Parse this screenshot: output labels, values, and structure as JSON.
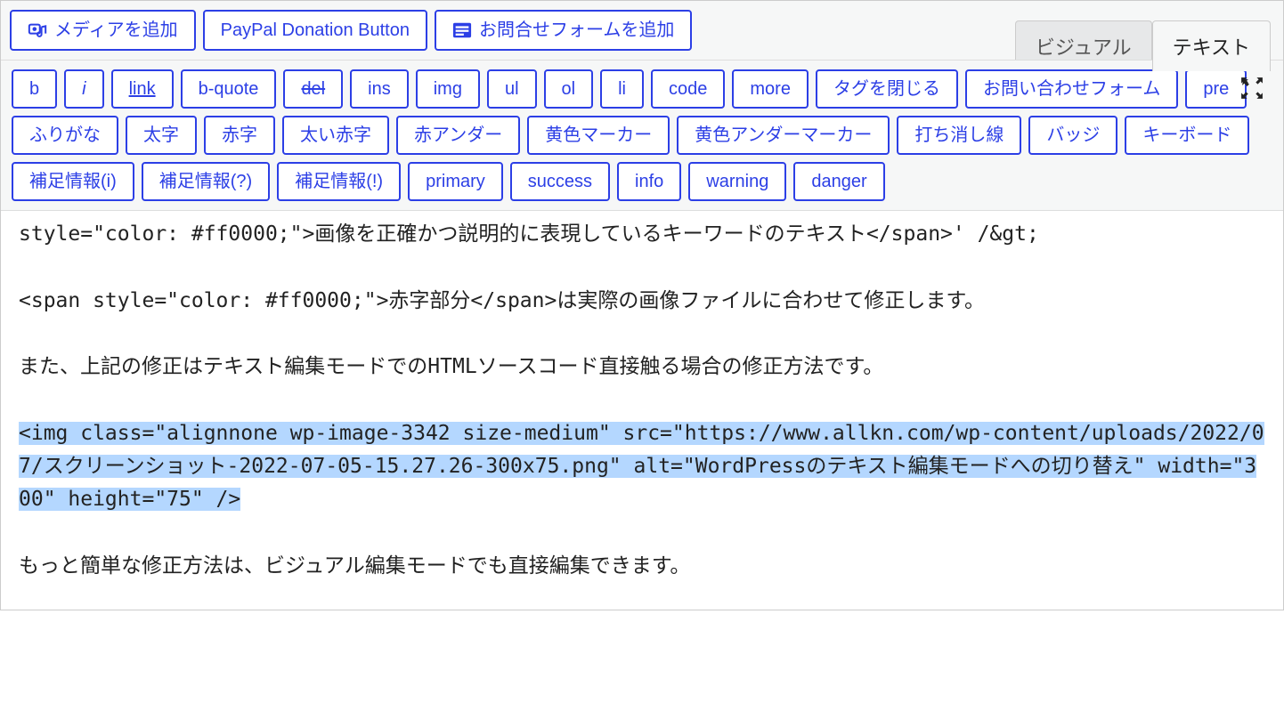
{
  "media_buttons": {
    "add_media": "メディアを追加",
    "paypal": "PayPal Donation Button",
    "add_form": "お問合せフォームを追加"
  },
  "tabs": {
    "visual": "ビジュアル",
    "text": "テキスト"
  },
  "quicktags": {
    "b": "b",
    "i": "i",
    "link": "link",
    "bquote": "b-quote",
    "del": "del",
    "ins": "ins",
    "img": "img",
    "ul": "ul",
    "ol": "ol",
    "li": "li",
    "code": "code",
    "more": "more",
    "close": "タグを閉じる",
    "contact": "お問い合わせフォーム",
    "pre": "pre",
    "furigana": "ふりがな",
    "bold": "太字",
    "red": "赤字",
    "boldred": "太い赤字",
    "redunder": "赤アンダー",
    "yellowmark": "黄色マーカー",
    "yellowunder": "黄色アンダーマーカー",
    "strike2": "打ち消し線",
    "badge": "バッジ",
    "keyboard": "キーボード",
    "info_i": "補足情報(i)",
    "info_q": "補足情報(?)",
    "info_e": "補足情報(!)",
    "primary": "primary",
    "success": "success",
    "info": "info",
    "warning": "warning",
    "danger": "danger"
  },
  "content": {
    "line1": "style=\"color: #ff0000;\">画像を正確かつ説明的に表現しているキーワードのテキスト</span>' /&gt;",
    "line2": "<span style=\"color: #ff0000;\">赤字部分</span>は実際の画像ファイルに合わせて修正します。",
    "line3": "また、上記の修正はテキスト編集モードでのHTMLソースコード直接触る場合の修正方法です。",
    "line4_sel": "<img class=\"alignnone wp-image-3342 size-medium\" src=\"https://www.allkn.com/wp-content/uploads/2022/07/スクリーンショット-2022-07-05-15.27.26-300x75.png\" alt=\"WordPressのテキスト編集モードへの切り替え\" width=\"300\" height=\"75\" />",
    "line5": "もっと簡単な修正方法は、ビジュアル編集モードでも直接編集できます。"
  }
}
